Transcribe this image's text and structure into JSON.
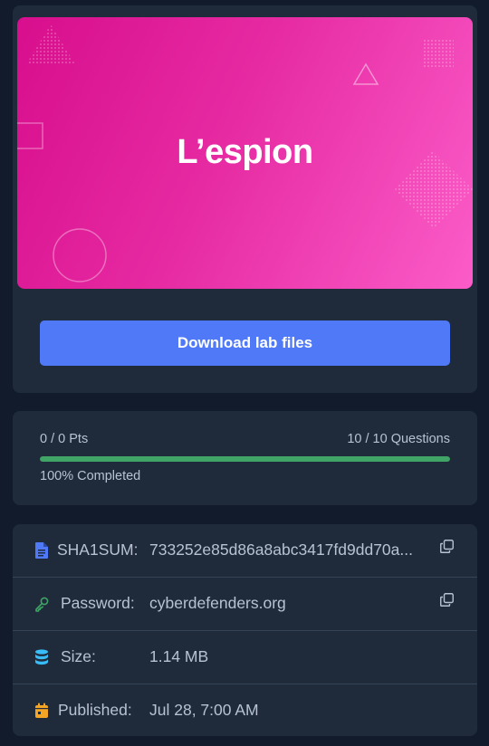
{
  "lab": {
    "banner_title": "L’espion",
    "download_label": "Download lab files"
  },
  "progress": {
    "points_text": "0 / 0 Pts",
    "questions_text": "10 / 10 Questions",
    "completed_text": "100% Completed",
    "percent": 100,
    "bar_color": "#3fa466"
  },
  "meta": {
    "sha1_label": "SHA1SUM:",
    "sha1_value": "733252e85d86a8abc3417fd9dd70a...",
    "password_label": "Password:",
    "password_value": "cyberdefenders.org",
    "size_label": "Size:",
    "size_value": "1.14 MB",
    "published_label": "Published:",
    "published_value": "Jul 28, 7:00 AM"
  },
  "colors": {
    "accent_button": "#5079f8",
    "banner_start": "#d80e8d",
    "banner_end": "#fb5cc8",
    "file_icon": "#5079f8",
    "key_icon": "#3fa466",
    "database_icon": "#38bdf8",
    "calendar_icon": "#f5a524"
  }
}
